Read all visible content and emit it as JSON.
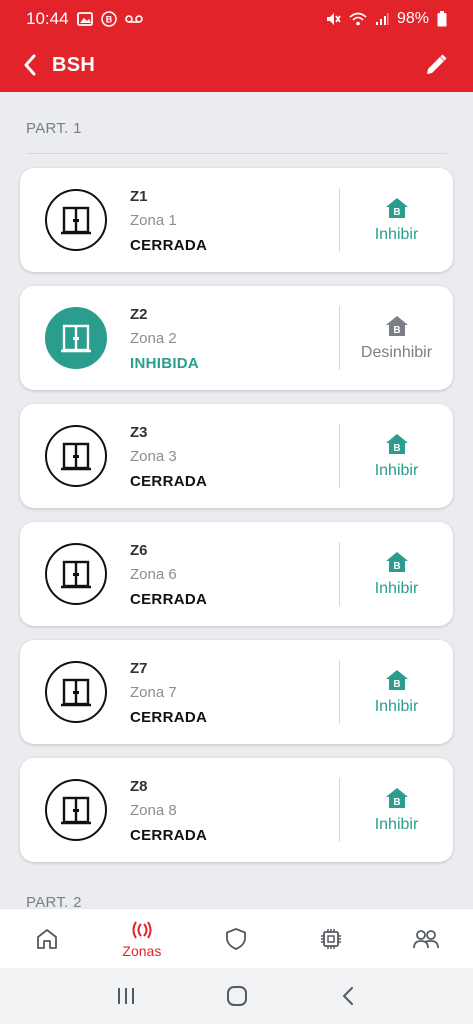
{
  "status_bar": {
    "time": "10:44",
    "battery": "98%",
    "icons": [
      "image-icon",
      "b-badge-icon",
      "voicemail-icon",
      "mute-icon",
      "wifi-icon",
      "signal-icon",
      "battery-icon"
    ]
  },
  "app_bar": {
    "title": "BSH",
    "back_icon": "chevron-left-icon",
    "edit_icon": "pencil-icon"
  },
  "partitions": [
    {
      "label": "PART. 1",
      "zones": [
        {
          "id": "Z1",
          "name": "Zona 1",
          "status": "CERRADA",
          "inhibited": false,
          "action": "Inhibir"
        },
        {
          "id": "Z2",
          "name": "Zona 2",
          "status": "INHIBIDA",
          "inhibited": true,
          "action": "Desinhibir"
        },
        {
          "id": "Z3",
          "name": "Zona 3",
          "status": "CERRADA",
          "inhibited": false,
          "action": "Inhibir"
        },
        {
          "id": "Z6",
          "name": "Zona 6",
          "status": "CERRADA",
          "inhibited": false,
          "action": "Inhibir"
        },
        {
          "id": "Z7",
          "name": "Zona 7",
          "status": "CERRADA",
          "inhibited": false,
          "action": "Inhibir"
        },
        {
          "id": "Z8",
          "name": "Zona 8",
          "status": "CERRADA",
          "inhibited": false,
          "action": "Inhibir"
        }
      ]
    },
    {
      "label": "PART. 2",
      "zones": []
    }
  ],
  "bottom_nav": {
    "items": [
      {
        "icon": "home-icon",
        "label": ""
      },
      {
        "icon": "zones-icon",
        "label": "Zonas",
        "active": true
      },
      {
        "icon": "shield-icon",
        "label": ""
      },
      {
        "icon": "chip-icon",
        "label": ""
      },
      {
        "icon": "users-icon",
        "label": ""
      }
    ]
  },
  "colors": {
    "brand_red": "#e3232a",
    "teal": "#2a9d8f",
    "background": "#eaecef"
  }
}
